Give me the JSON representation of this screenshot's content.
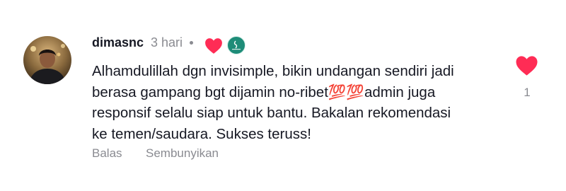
{
  "comment": {
    "username": "dimasnc",
    "time": "3 hari",
    "text": "Alhamdulillah dgn invisimple, bikin undangan sendiri jadi\nberasa gampang bgt dijamin no-ribet💯💯admin juga\nresponsif selalu siap untuk bantu. Bakalan rekomendasi\nke temen/saudara. Sukses teruss!",
    "like_count": "1",
    "liked_by_creator": true
  },
  "actions": {
    "reply_label": "Balas",
    "hide_label": "Sembunyikan"
  },
  "icons": {
    "liked_heart": "heart-icon",
    "creator_badge": "creator-avatar-icon",
    "like_button": "heart-icon"
  },
  "colors": {
    "heart_red": "#ff2c55",
    "username": "#161823",
    "meta_gray": "#8a8b91",
    "creator_badge_bg": "#1e8c78"
  }
}
